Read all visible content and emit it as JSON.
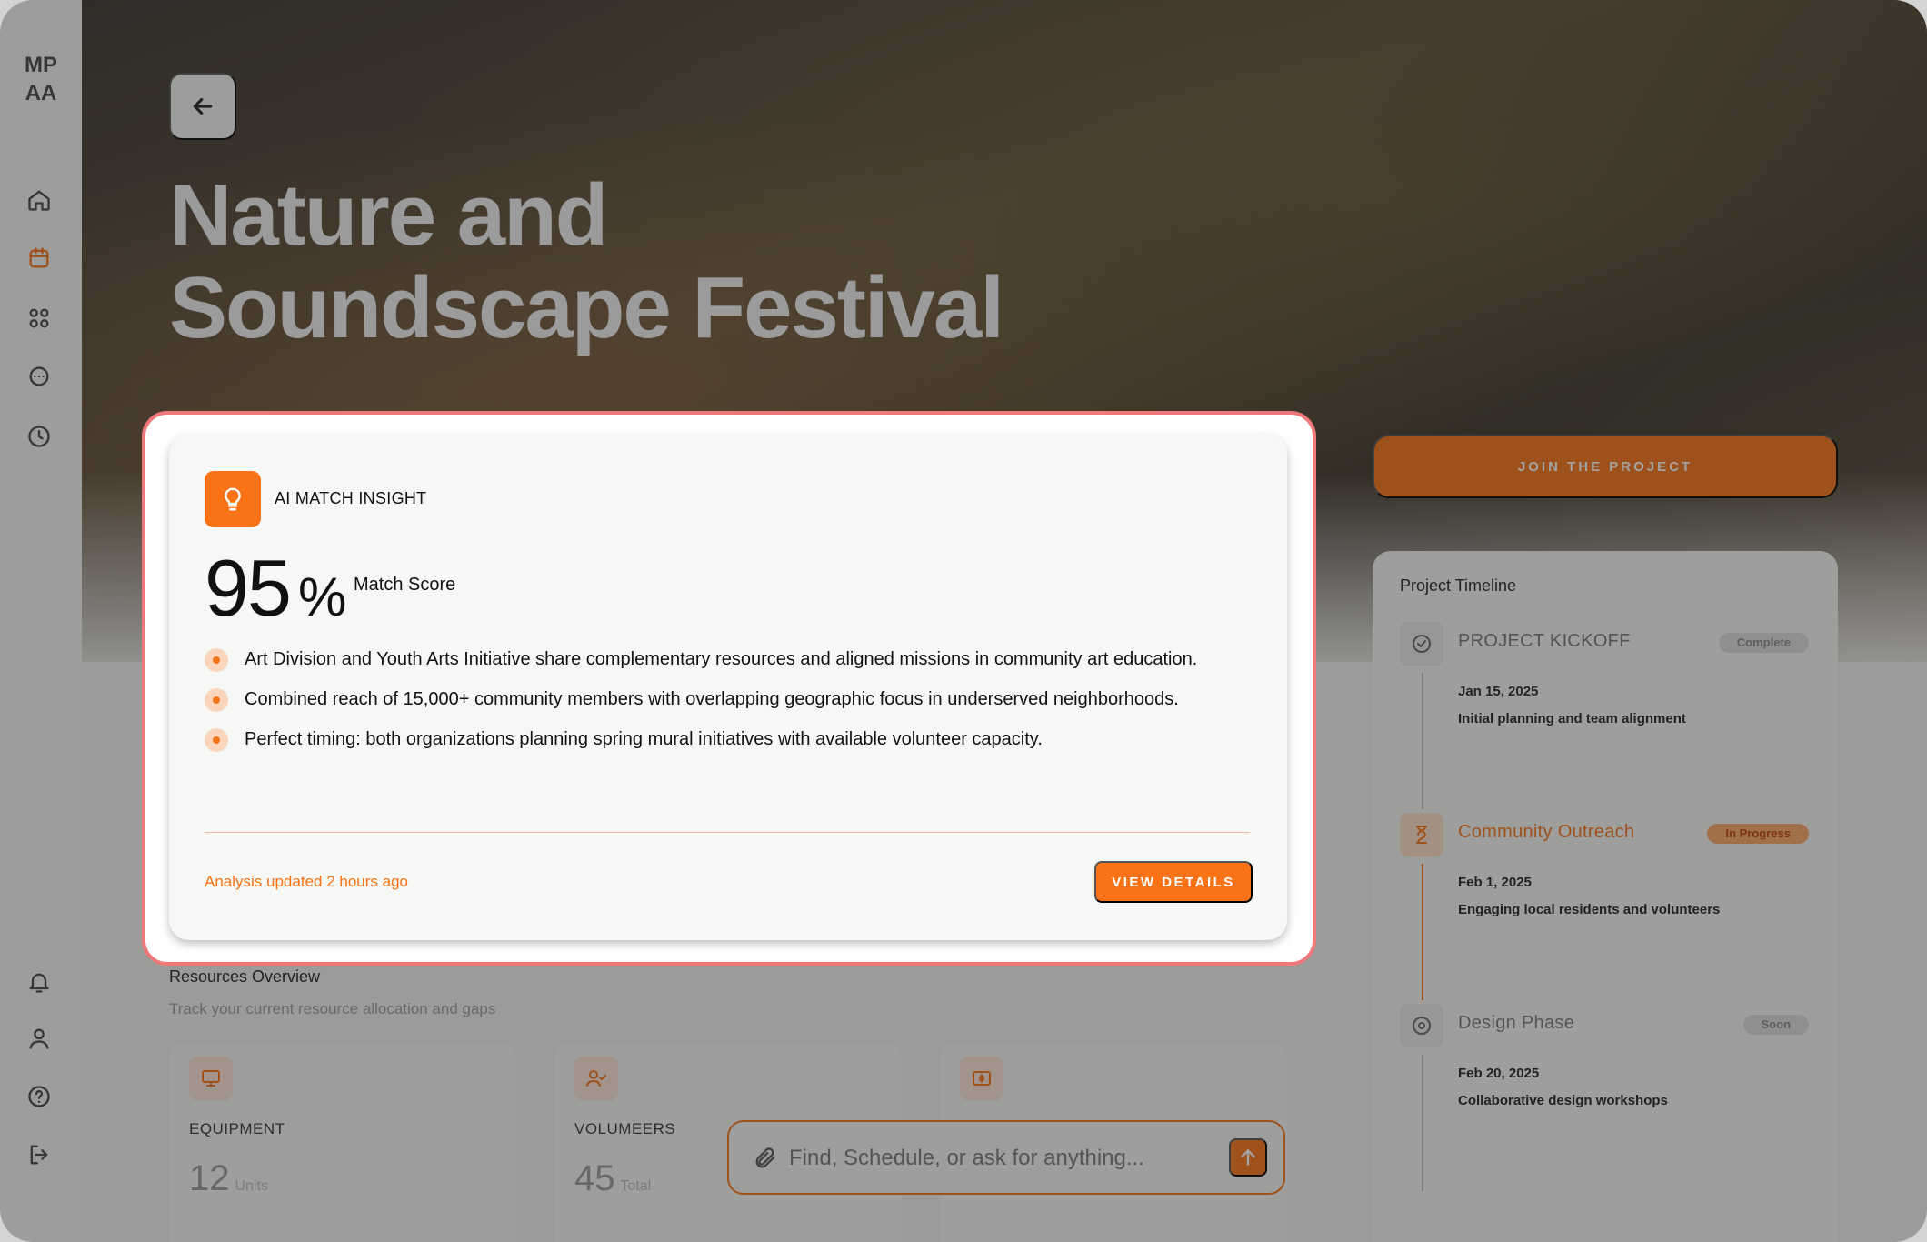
{
  "sidebar": {
    "logo_line1": "MP",
    "logo_line2": "AA",
    "nav_top": [
      {
        "icon": "home-icon"
      },
      {
        "icon": "calendar-icon",
        "active": true
      },
      {
        "icon": "grid-icon"
      },
      {
        "icon": "chat-icon"
      },
      {
        "icon": "clock-icon"
      }
    ],
    "nav_bottom": [
      {
        "icon": "bell-icon"
      },
      {
        "icon": "user-icon"
      },
      {
        "icon": "help-icon"
      },
      {
        "icon": "logout-icon"
      }
    ]
  },
  "hero": {
    "title_line1": "Nature and",
    "title_line2": "Soundscape Festival"
  },
  "actions": {
    "join_label": "JOIN THE PROJECT"
  },
  "insight": {
    "title": "AI MATCH INSIGHT",
    "score": "95",
    "score_suffix": "%",
    "score_label": "Match Score",
    "bullets": [
      "Art Division and Youth Arts Initiative share complementary resources and aligned missions in community art education.",
      "Combined reach of 15,000+ community members with overlapping geographic focus in underserved neighborhoods.",
      "Perfect timing: both organizations planning spring mural initiatives with available volunteer capacity."
    ],
    "updated": "Analysis updated 2 hours ago",
    "view_label": "VIEW DETAILS"
  },
  "resources": {
    "title": "Resources Overview",
    "subtitle": "Track your current resource allocation and gaps",
    "cards": [
      {
        "label": "EQUIPMENT",
        "value": "12",
        "unit": "Units"
      },
      {
        "label": "VOLUMEERS",
        "value": "45",
        "unit": "Total"
      },
      {
        "label": "",
        "value": "",
        "unit": ""
      }
    ]
  },
  "timeline": {
    "title": "Project Timeline",
    "items": [
      {
        "name": "PROJECT KICKOFF",
        "badge": "Complete",
        "date": "Jan 15, 2025",
        "desc": "Initial planning and team alignment"
      },
      {
        "name": "Community Outreach",
        "badge": "In Progress",
        "date": "Feb 1, 2025",
        "desc": "Engaging local residents and volunteers"
      },
      {
        "name": "Design Phase",
        "badge": "Soon",
        "date": "Feb 20, 2025",
        "desc": "Collaborative design workshops"
      }
    ]
  },
  "chat": {
    "placeholder": "Find, Schedule, or ask for anything..."
  },
  "colors": {
    "accent": "#f97316",
    "highlight_border": "#f0787a"
  }
}
